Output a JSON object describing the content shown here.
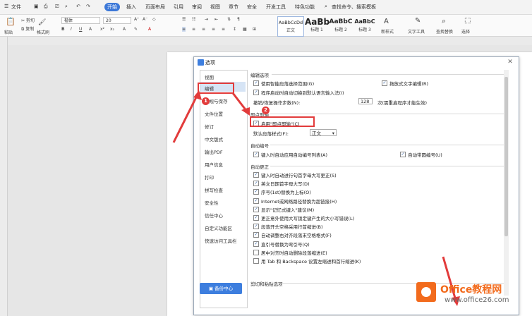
{
  "menubar": {
    "file": "文件",
    "tabs": [
      "开始",
      "插入",
      "页面布局",
      "引用",
      "审阅",
      "视图",
      "章节",
      "安全",
      "开发工具",
      "特色功能"
    ],
    "active_tab": "开始",
    "search": "查找命令、搜索模板"
  },
  "ribbon": {
    "paste": "粘贴",
    "cut": "剪切",
    "copy": "复制",
    "format_painter": "格式刷",
    "font_name": "楷体",
    "font_size": "20",
    "styles": [
      {
        "sample": "AaBbCcDd",
        "label": "正文"
      },
      {
        "sample": "AaBb",
        "label": "标题 1"
      },
      {
        "sample": "AaBbC",
        "label": "标题 2"
      },
      {
        "sample": "AaBbC",
        "label": "标题 3"
      }
    ],
    "new_style": "新样式",
    "text_tools": "文字工具",
    "find_replace": "查找替换",
    "select": "选择"
  },
  "dialog": {
    "title": "选项",
    "nav": [
      "视图",
      "编辑",
      "常规与保存",
      "文件位置",
      "修订",
      "中文版式",
      "输出PDF",
      "用户信息",
      "打印",
      "拼写检查",
      "安全性",
      "信任中心",
      "自定义功能区",
      "快速访问工具栏"
    ],
    "backup": "备份中心",
    "sections": {
      "edit_options": "编辑选项",
      "paste_smart": "使用智能段落选择范围(G)",
      "drag_edit": "拖放式文字编辑(R)",
      "auto_switch": "程序启动时自动切换到默认语言输入法(I)",
      "undo_steps_label": "撤销/恢复操作步数(N):",
      "undo_steps": "128",
      "undo_suffix": "次(需重启程序才能生效)",
      "click_input": "即点即输",
      "enable_click_input": "启用\"即点即输\"(C)",
      "default_para_style_label": "默认段落样式(F):",
      "default_para_style": "正文",
      "auto_numbering": "自动编号",
      "key_input_numbering": "键入时自动应用自动编号列表(A)",
      "auto_bullets": "自动带圆编号(U)",
      "auto_correct": "自动更正",
      "ac_items": [
        "键入时自动进行句首字母大写更正(S)",
        "英文日期首字母大写(D)",
        "序号(1st)替换为上标(O)",
        "Internet或网络路径替换为超链接(H)",
        "显示\"记忆式键入\"建议(M)",
        "更正意外使用大写锁定键产生的大小写错误(L)",
        "段落开头空格采用行首缩进(B)",
        "自动调整右对齐段落末空格格式(F)",
        "直引号替换为弯引号(Q)",
        "居中对齐时自动删除段落缩进(E)",
        "用 Tab 和 Backspace 设置左缩进和首行缩进(K)"
      ],
      "ac_checked": [
        true,
        true,
        true,
        true,
        true,
        true,
        true,
        true,
        true,
        false,
        false
      ],
      "cut_paste": "剪切和粘贴选项"
    }
  },
  "annotations": {
    "badge1": "1",
    "badge2": "2"
  },
  "watermark": {
    "line1": "Office教程网",
    "line2": "www.office26.com"
  },
  "colors": {
    "accent": "#3d7ede",
    "annotation": "#e23b3b",
    "watermark_orange": "#f26b1d"
  }
}
